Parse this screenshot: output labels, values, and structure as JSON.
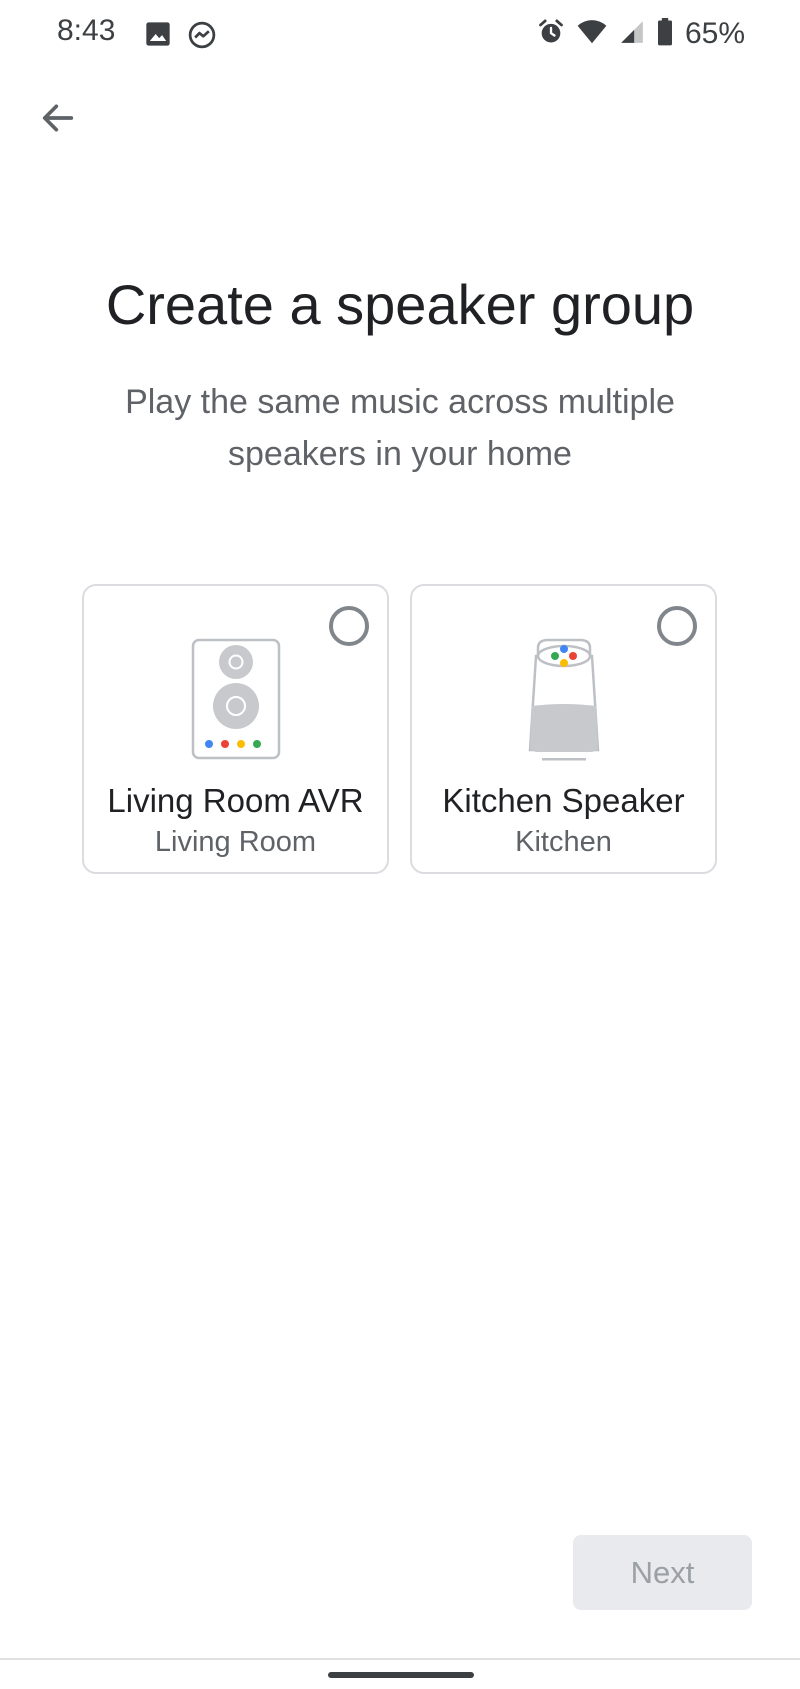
{
  "status_bar": {
    "time": "8:43",
    "battery": "65%",
    "left_icons": [
      "image-icon",
      "messenger-icon"
    ],
    "right_icons": [
      "alarm-icon",
      "wifi-icon",
      "signal-icon",
      "battery-icon"
    ]
  },
  "header": {
    "back_icon": "arrow-back-icon"
  },
  "main": {
    "title": "Create a speaker group",
    "subtitle": "Play the same music across multiple speakers in your home"
  },
  "devices": [
    {
      "name": "Living Room AVR",
      "room": "Living Room",
      "icon": "avr-speaker-icon",
      "selected": false
    },
    {
      "name": "Kitchen Speaker",
      "room": "Kitchen",
      "icon": "google-home-icon",
      "selected": false
    }
  ],
  "footer": {
    "next_label": "Next",
    "next_enabled": false
  },
  "colors": {
    "google_blue": "#4285f4",
    "google_red": "#ea4335",
    "google_yellow": "#fbbc04",
    "google_green": "#34a853",
    "disabled_button_bg": "#e8eaed",
    "disabled_button_text": "#9aa0a6"
  }
}
